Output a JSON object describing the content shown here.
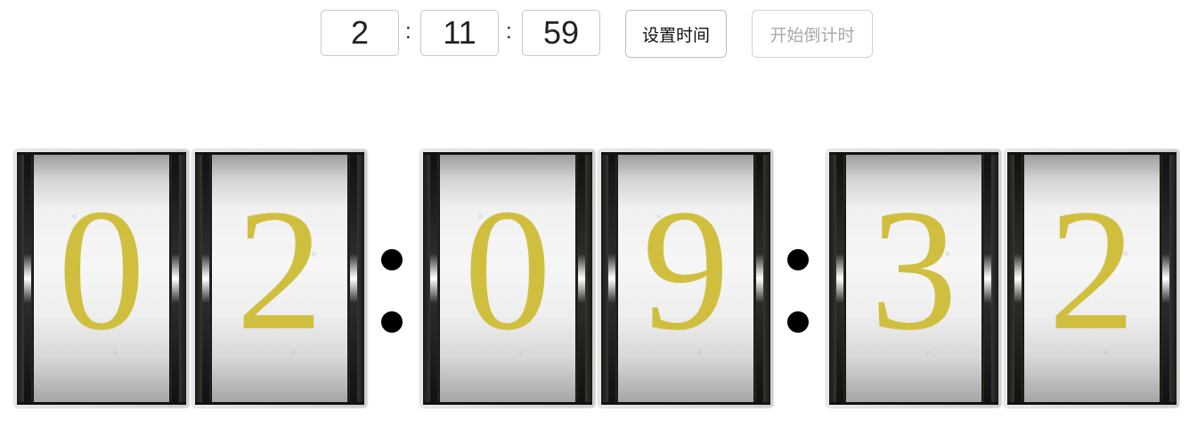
{
  "controls": {
    "hours_value": "2",
    "minutes_value": "11",
    "seconds_value": "59",
    "separator": ":",
    "set_time_label": "设置时间",
    "start_countdown_label": "开始倒计时"
  },
  "clock": {
    "digits": [
      "0",
      "2",
      "0",
      "9",
      "3",
      "2"
    ],
    "digit_color": "#d0bf3f"
  }
}
